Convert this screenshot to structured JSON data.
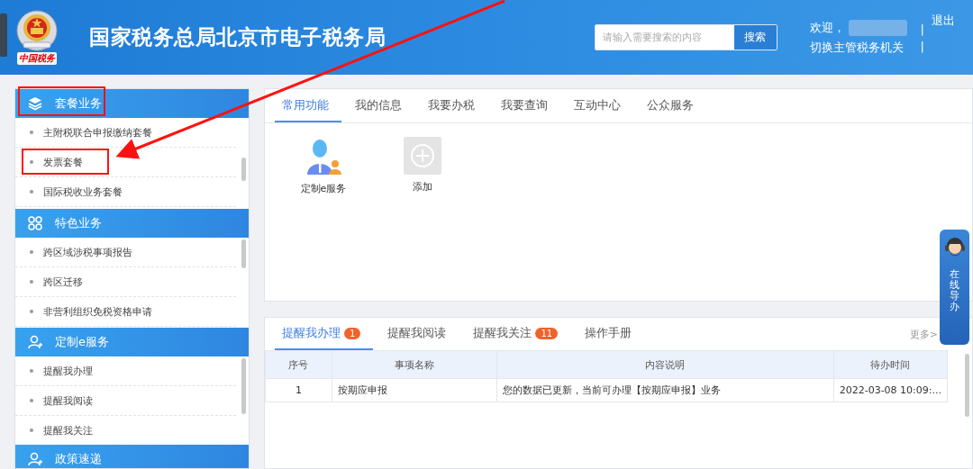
{
  "header": {
    "title": "国家税务总局北京市电子税务局",
    "logo_caption": "中国税务",
    "search": {
      "placeholder": "请输入需要搜索的内容",
      "button": "搜索"
    },
    "welcome": "欢迎，",
    "switch_link": "切换主管税务机关",
    "separators": [
      "|",
      "|"
    ],
    "logout": "退出"
  },
  "sidebar": {
    "sections": [
      {
        "title": "套餐业务",
        "items": [
          "主附税联合申报缴纳套餐",
          "发票套餐",
          "国际税收业务套餐"
        ]
      },
      {
        "title": "特色业务",
        "items": [
          "跨区域涉税事项报告",
          "跨区迁移",
          "非营利组织免税资格申请"
        ]
      },
      {
        "title": "定制e服务",
        "items": [
          "提醒我办理",
          "提醒我阅读",
          "提醒我关注"
        ]
      },
      {
        "title": "政策速递"
      }
    ]
  },
  "main_tabs": [
    {
      "label": "常用功能",
      "selected": true
    },
    {
      "label": "我的信息",
      "selected": false
    },
    {
      "label": "我要办税",
      "selected": false
    },
    {
      "label": "我要查询",
      "selected": false
    },
    {
      "label": "互动中心",
      "selected": false
    },
    {
      "label": "公众服务",
      "selected": false
    }
  ],
  "shortcuts": [
    {
      "label": "定制e服务",
      "kind": "service"
    },
    {
      "label": "添加",
      "kind": "add"
    }
  ],
  "reminder_panel": {
    "tabs": [
      {
        "label": "提醒我办理",
        "badge": "1",
        "selected": true
      },
      {
        "label": "提醒我阅读",
        "selected": false
      },
      {
        "label": "提醒我关注",
        "badge": "11",
        "selected": false
      },
      {
        "label": "操作手册",
        "selected": false
      }
    ],
    "more": "更多>",
    "table": {
      "columns": [
        "序号",
        "事项名称",
        "内容说明",
        "待办时间"
      ],
      "rows": [
        [
          "1",
          "按期应申报",
          "您的数据已更新，当前可办理【按期应申报】业务",
          "2022-03-08 10:09:..."
        ]
      ]
    }
  },
  "float_widget": {
    "label": "在线导办"
  }
}
